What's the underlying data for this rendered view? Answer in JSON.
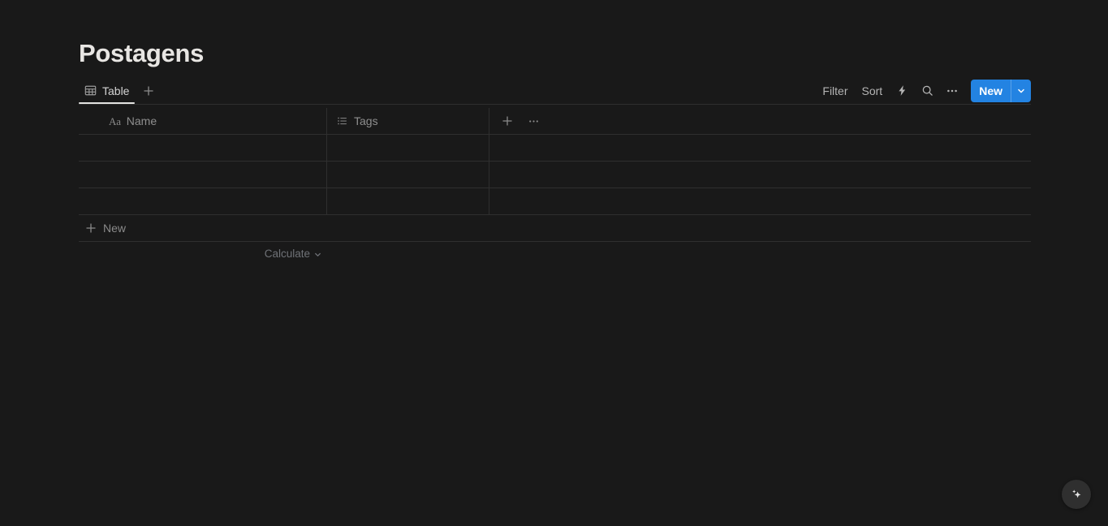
{
  "page": {
    "title": "Postagens",
    "background_color": "#191919"
  },
  "view_bar": {
    "tabs": [
      {
        "label": "Table",
        "icon": "table-icon",
        "active": true
      }
    ],
    "add_view_icon": "plus-icon",
    "toolbar": {
      "filter_label": "Filter",
      "sort_label": "Sort",
      "automation_icon": "lightning-bolt-icon",
      "search_icon": "search-icon",
      "more_icon": "ellipsis-icon",
      "new_label": "New",
      "new_caret_icon": "chevron-down-icon",
      "accent_color": "#2383e2"
    }
  },
  "table": {
    "columns": [
      {
        "name": "Name",
        "icon": "title-text-icon",
        "icon_label": "Aa"
      },
      {
        "name": "Tags",
        "icon": "multi-select-list-icon"
      }
    ],
    "header_actions": {
      "add_column_icon": "plus-icon",
      "more_icon": "ellipsis-icon"
    },
    "rows": [
      {
        "name": "",
        "tags": ""
      },
      {
        "name": "",
        "tags": ""
      },
      {
        "name": "",
        "tags": ""
      }
    ],
    "new_row": {
      "icon": "plus-icon",
      "label": "New"
    },
    "footer": {
      "calculate_label": "Calculate",
      "caret_icon": "chevron-down-icon"
    }
  },
  "floating_button": {
    "icon": "sparkle-ai-icon",
    "background_color": "#2f2f2f"
  }
}
